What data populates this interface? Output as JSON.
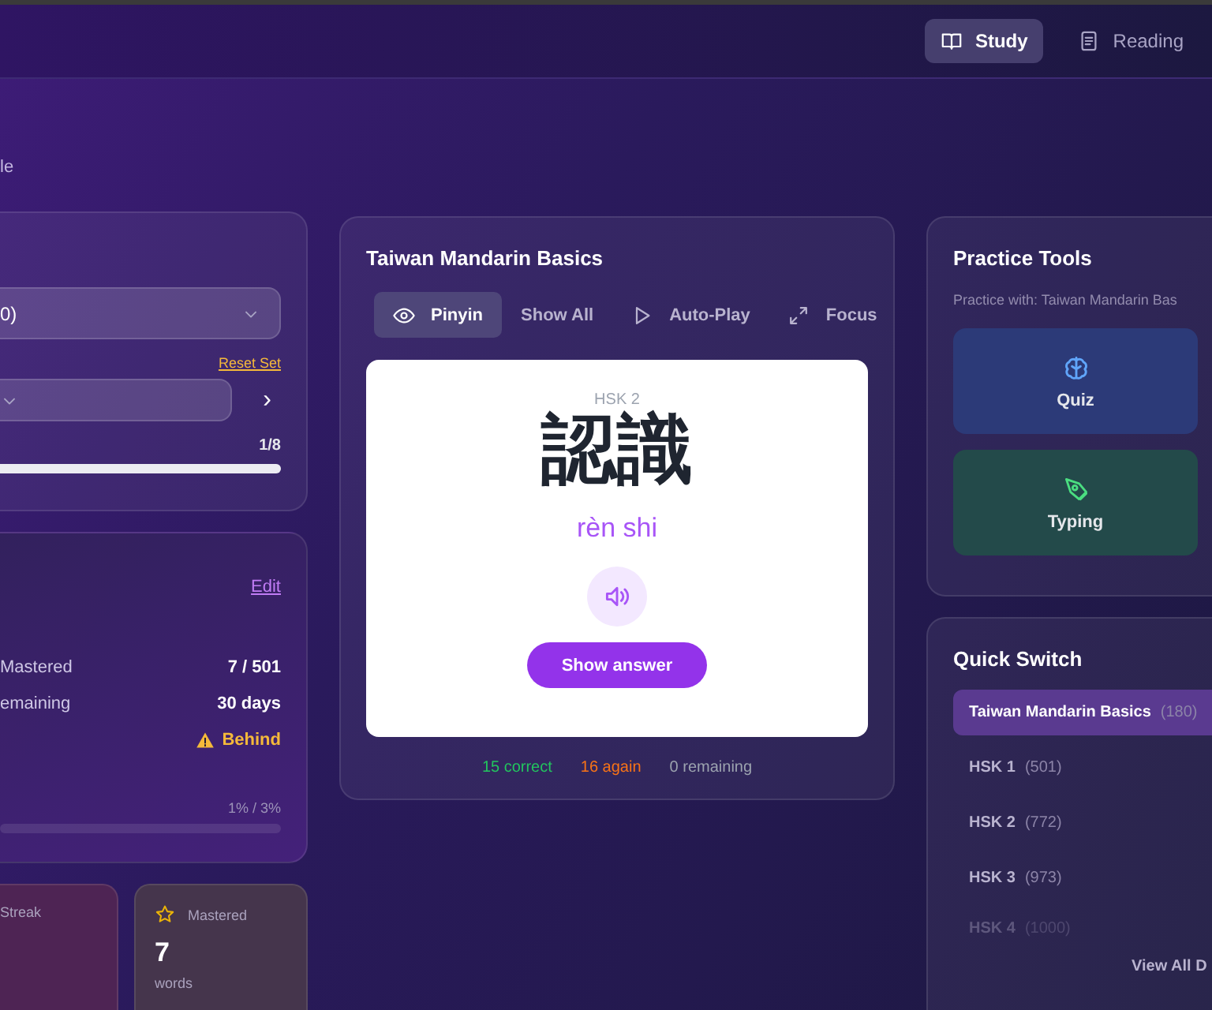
{
  "nav": {
    "tabs": [
      {
        "label": "Study",
        "selected": true
      },
      {
        "label": "Reading",
        "selected": false
      }
    ]
  },
  "header": {
    "subtitle": "le"
  },
  "set_card": {
    "set_select": {
      "value": "0)"
    },
    "reset_link": "Reset Set",
    "next": "›",
    "progress_text": "1/8",
    "level": 1
  },
  "goal_card": {
    "edit_link": "Edit",
    "rows": [
      {
        "label": "Mastered",
        "value": "7 / 501",
        "kind": "plain"
      },
      {
        "label": "emaining",
        "value": "30 days",
        "kind": "plain"
      },
      {
        "value": "Behind",
        "kind": "warning"
      }
    ],
    "progress_text": "1% / 3%"
  },
  "stat_cards": [
    {
      "label": "Streak",
      "kind": "streak"
    },
    {
      "label": "Mastered",
      "kind": "mastered",
      "value": "7",
      "unit": "words"
    }
  ],
  "study_card": {
    "title": "Taiwan Mandarin Basics",
    "modes": [
      {
        "label": "Pinyin",
        "selected": true
      },
      {
        "label": "Show All",
        "selected": false
      },
      {
        "label": "Auto-Play",
        "selected": false
      },
      {
        "label": "Focus",
        "selected": false
      }
    ],
    "flashcard": {
      "level_tag": "HSK 2",
      "hanzi": "認識",
      "pinyin": "rèn shi",
      "answer_button": "Show answer"
    },
    "stats": [
      {
        "count": "15",
        "label": "correct",
        "color": "#22c55e"
      },
      {
        "count": "16",
        "label": "again",
        "color": "#f97316"
      },
      {
        "count": "0",
        "label": "remaining",
        "color": "#9ca3af"
      }
    ]
  },
  "practice_tools": {
    "title": "Practice Tools",
    "subtitle": "Practice with: Taiwan Mandarin Bas",
    "tools": [
      {
        "label": "Quiz",
        "kind": "quiz"
      },
      {
        "label": "Typing",
        "kind": "typing"
      }
    ]
  },
  "quick_switch": {
    "title": "Quick Switch",
    "items": [
      {
        "name": "Taiwan Mandarin Basics",
        "count": "(180)",
        "selected": true
      },
      {
        "name": "HSK 1",
        "count": "(501)",
        "selected": false
      },
      {
        "name": "HSK 2",
        "count": "(772)",
        "selected": false
      },
      {
        "name": "HSK 3",
        "count": "(973)",
        "selected": false
      },
      {
        "name": "HSK 4",
        "count": "(1000)",
        "selected": false
      }
    ],
    "view_all": "View All D"
  }
}
